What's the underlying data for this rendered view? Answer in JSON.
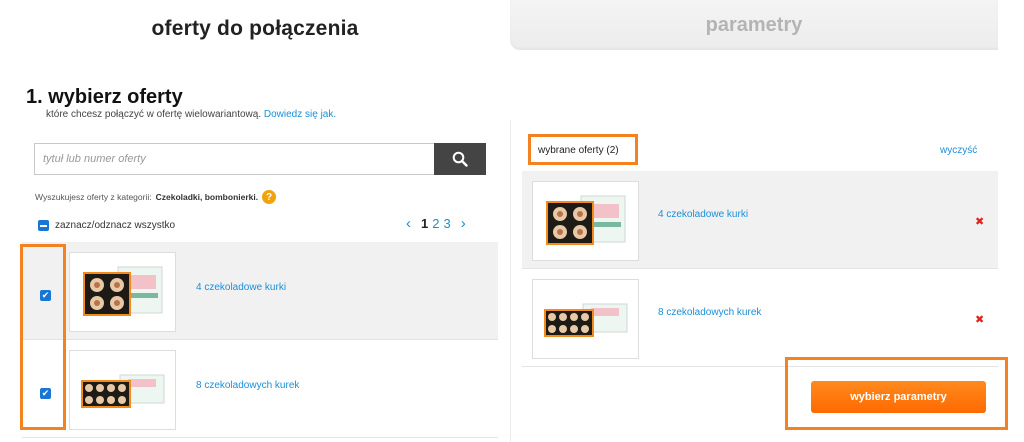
{
  "tabs": {
    "active": "oferty do połączenia",
    "inactive": "parametry"
  },
  "step": {
    "title": "1. wybierz oferty",
    "subtitle": "które chcesz połączyć w ofertę wielowariantową.",
    "help_link": "Dowiedz się jak."
  },
  "search": {
    "placeholder": "tytuł lub numer oferty",
    "value": "",
    "button_icon": "search-icon"
  },
  "category_note": {
    "prefix": "Wyszukujesz oferty z kategorii:",
    "category": "Czekoladki, bombonierki.",
    "help_icon": "?"
  },
  "select_all_label": "zaznacz/odznacz wszystko",
  "pager": {
    "prev": "‹",
    "next": "›",
    "current": "1",
    "pages": [
      "2",
      "3"
    ]
  },
  "left_offers": [
    {
      "title": "4 czekoladowe kurki",
      "checked": true,
      "checkmark": "✔"
    },
    {
      "title": "8 czekoladowych kurek",
      "checked": true,
      "checkmark": "✔"
    }
  ],
  "right_panel": {
    "selected_label": "wybrane oferty (2)",
    "clear_label": "wyczyść",
    "remove_icon": "✖",
    "offers": [
      {
        "title": "4 czekoladowe kurki"
      },
      {
        "title": "8 czekoladowych kurek"
      }
    ],
    "next_button": "wybierz parametry"
  },
  "colors": {
    "accent_blue": "#1a8fd8",
    "highlight_orange": "#f58220",
    "button_orange": "#ff6a00",
    "remove_red": "#e0241b"
  }
}
